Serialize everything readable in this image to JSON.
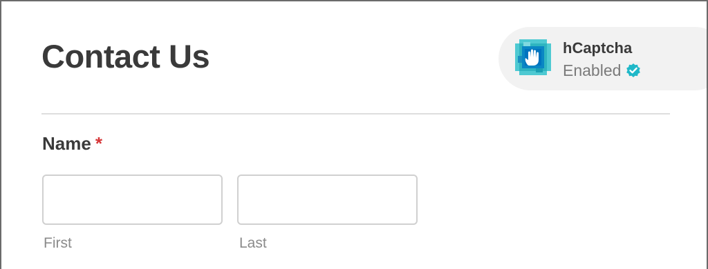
{
  "form": {
    "title": "Contact Us"
  },
  "badge": {
    "name": "hCaptcha",
    "status": "Enabled",
    "logo_icon": "hcaptcha-logo-icon",
    "status_icon": "verified-check-icon",
    "colors": {
      "background": "#f2f2f2",
      "check": "#1fb8c8",
      "logo_teal": "#2fb4c0",
      "logo_blue": "#0074bf"
    }
  },
  "fields": {
    "name": {
      "label": "Name",
      "required_marker": "*",
      "first": {
        "value": "",
        "placeholder": "",
        "sublabel": "First"
      },
      "last": {
        "value": "",
        "placeholder": "",
        "sublabel": "Last"
      }
    }
  },
  "colors": {
    "required": "#d63638",
    "divider": "#dedede",
    "input_border": "#d0d0d0"
  }
}
